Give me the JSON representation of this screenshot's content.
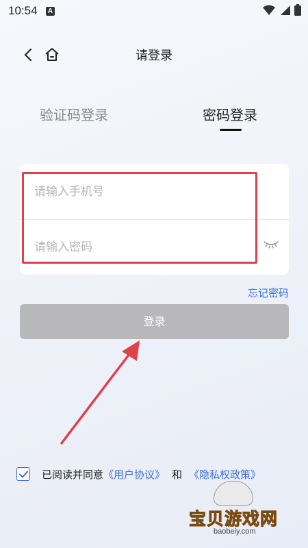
{
  "status_bar": {
    "time": "10:54",
    "notification_letter": "A"
  },
  "nav": {
    "title": "请登录"
  },
  "tabs": [
    {
      "label": "验证码登录",
      "active": false
    },
    {
      "label": "密码登录",
      "active": true
    }
  ],
  "form": {
    "phone_placeholder": "请输入手机号",
    "password_placeholder": "请输入密码"
  },
  "forgot_password": "忘记密码",
  "login_button": "登录",
  "agreement": {
    "checked": true,
    "prefix": "已阅读并同意",
    "user_agreement": "《用户协议》",
    "and": "和",
    "privacy_policy": "《隐私权政策》"
  },
  "watermark": {
    "title": "宝贝游戏网",
    "domain": "baobeiy.com"
  },
  "colors": {
    "accent": "#3b6fd6",
    "button_disabled": "#b8b8bb",
    "annotation_red": "#e0404a"
  }
}
